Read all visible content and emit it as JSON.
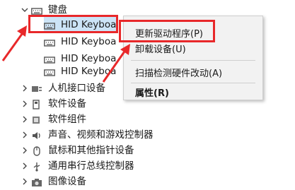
{
  "tree": {
    "keyboard_category": {
      "label": "键盘",
      "icon": "keyboard-icon",
      "expander": "collapse-chevron"
    },
    "keyboard_children": [
      {
        "label": "HID Keyboa"
      },
      {
        "label": "HID Keyboa"
      },
      {
        "label": "HID Keyboa"
      },
      {
        "label": "HID Keyboa"
      }
    ],
    "categories": [
      {
        "label": "人机接口设备",
        "icon": "hid-icon"
      },
      {
        "label": "软件设备",
        "icon": "software-device-icon"
      },
      {
        "label": "软件组件",
        "icon": "software-component-icon"
      },
      {
        "label": "声音、视频和游戏控制器",
        "icon": "speaker-icon"
      },
      {
        "label": "鼠标和其他指针设备",
        "icon": "mouse-icon"
      },
      {
        "label": "通用串行总线控制器",
        "icon": "usb-icon"
      },
      {
        "label": "图像设备",
        "icon": "camera-icon"
      }
    ]
  },
  "context_menu": {
    "update_driver": "更新驱动程序(P)",
    "uninstall_device": "卸载设备(U)",
    "scan_hardware": "扫描检测硬件改动(A)",
    "properties": "属性(R)"
  },
  "colors": {
    "highlight": "#e8282a",
    "menu_bg": "#f2f2f2"
  }
}
